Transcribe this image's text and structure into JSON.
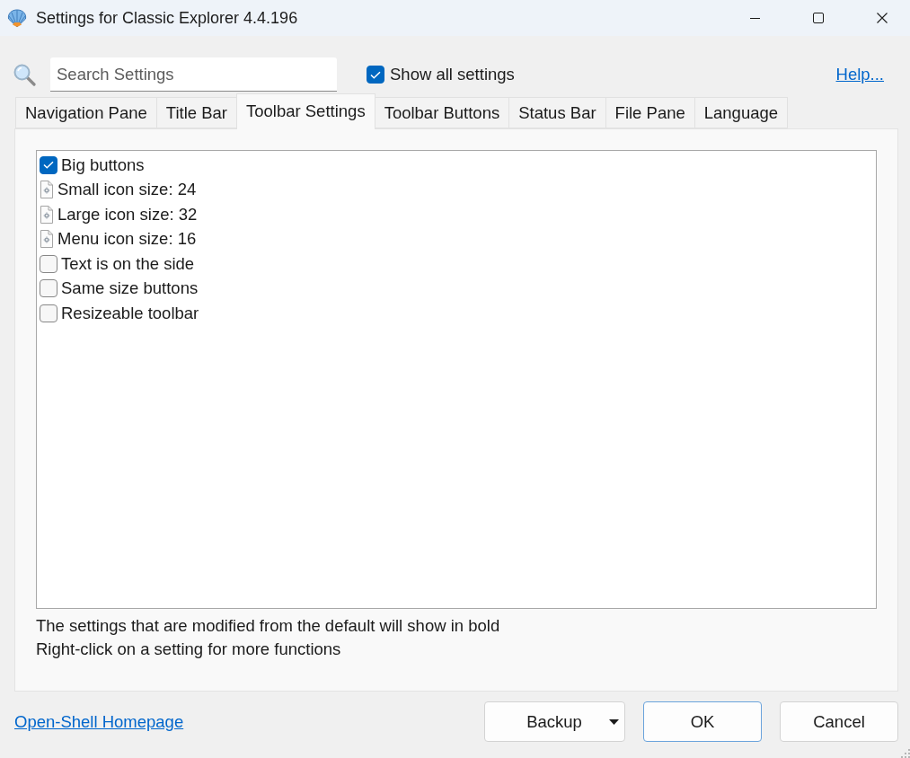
{
  "window": {
    "title": "Settings for Classic Explorer 4.4.196"
  },
  "search": {
    "placeholder": "Search Settings"
  },
  "show_all": {
    "label": "Show all settings",
    "checked": true
  },
  "help_link": "Help...",
  "tabs": [
    {
      "label": "Navigation Pane",
      "selected": false
    },
    {
      "label": "Title Bar",
      "selected": false
    },
    {
      "label": "Toolbar Settings",
      "selected": true
    },
    {
      "label": "Toolbar Buttons",
      "selected": false
    },
    {
      "label": "Status Bar",
      "selected": false
    },
    {
      "label": "File Pane",
      "selected": false
    },
    {
      "label": "Language",
      "selected": false
    }
  ],
  "settings": [
    {
      "kind": "checkbox",
      "label": "Big buttons",
      "checked": true
    },
    {
      "kind": "value",
      "label": "Small icon size: 24"
    },
    {
      "kind": "value",
      "label": "Large icon size: 32"
    },
    {
      "kind": "value",
      "label": "Menu icon size: 16"
    },
    {
      "kind": "checkbox",
      "label": "Text is on the side",
      "checked": false
    },
    {
      "kind": "checkbox",
      "label": "Same size buttons",
      "checked": false
    },
    {
      "kind": "checkbox",
      "label": "Resizeable toolbar",
      "checked": false
    }
  ],
  "notes": [
    "The settings that are modified from the default will show in bold",
    "Right-click on a setting for more functions"
  ],
  "homepage_link": "Open-Shell Homepage",
  "buttons": [
    {
      "label": "Backup",
      "kind": "dropdown"
    },
    {
      "label": "OK",
      "kind": "default"
    },
    {
      "label": "Cancel",
      "kind": "plain"
    }
  ]
}
